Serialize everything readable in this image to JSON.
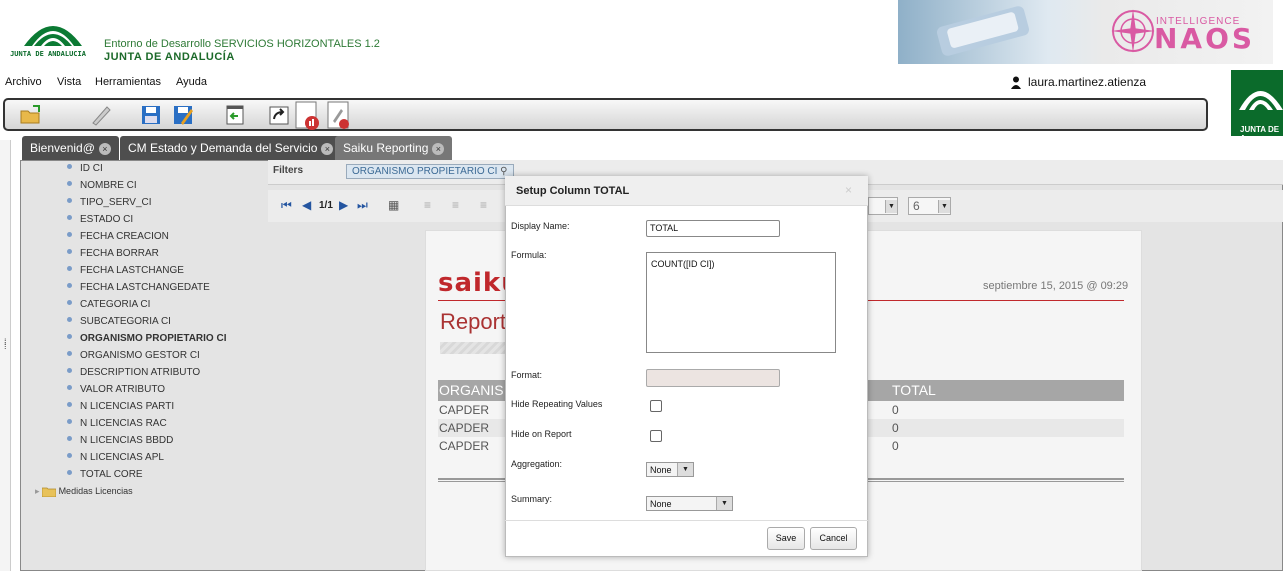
{
  "header": {
    "logo_text": "JUNTA DE ANDALUCIA",
    "env_title": "Entorno de Desarrollo SERVICIOS HORIZONTALES 1.2",
    "org_title": "JUNTA DE ANDALUCÍA",
    "banner_intel": "INTELLIGENCE",
    "banner_naos": "NAOS",
    "side_logo_text": "JUNTA DE A"
  },
  "menubar": {
    "items": [
      "Archivo",
      "Vista",
      "Herramientas",
      "Ayuda"
    ],
    "user": "laura.martinez.atienza"
  },
  "tabs": [
    {
      "label": "Bienvenid@"
    },
    {
      "label": "CM Estado y Demanda del Servicio"
    },
    {
      "label": "Saiku Reporting"
    }
  ],
  "tree": {
    "items": [
      "ID CI",
      "NOMBRE CI",
      "TIPO_SERV_CI",
      "ESTADO CI",
      "FECHA CREACION",
      "FECHA BORRAR",
      "FECHA LASTCHANGE",
      "FECHA LASTCHANGEDATE",
      "CATEGORIA CI",
      "SUBCATEGORIA CI",
      "ORGANISMO PROPIETARIO CI",
      "ORGANISMO GESTOR CI",
      "DESCRIPTION ATRIBUTO",
      "VALOR ATRIBUTO",
      "N LICENCIAS PARTI",
      "N LICENCIAS RAC",
      "N LICENCIAS BBDD",
      "N LICENCIAS APL",
      "TOTAL CORE"
    ],
    "folder": "Medidas Licencias"
  },
  "workspace": {
    "filters_label": "Filters",
    "filter_chip": "ORGANISMO PROPIETARIO CI",
    "pager": "1/1",
    "select_right": "6"
  },
  "report": {
    "logo": "saiku",
    "date": "septiembre 15, 2015 @ 09:29",
    "title": "Report",
    "col1": "ORGANIS",
    "col2": "TOTAL",
    "rows": [
      {
        "org": "CAPDER",
        "total": "0"
      },
      {
        "org": "CAPDER",
        "total": "0"
      },
      {
        "org": "CAPDER",
        "total": "0"
      }
    ]
  },
  "dialog": {
    "title": "Setup Column TOTAL",
    "close": "×",
    "display_name_label": "Display Name:",
    "display_name_value": "TOTAL",
    "formula_label": "Formula:",
    "formula_value": "COUNT([ID CI])",
    "format_label": "Format:",
    "hide_repeating_label": "Hide Repeating Values",
    "hide_on_report_label": "Hide on Report",
    "aggregation_label": "Aggregation:",
    "aggregation_value": "None",
    "summary_label": "Summary:",
    "summary_value": "None",
    "save_label": "Save",
    "cancel_label": "Cancel"
  }
}
